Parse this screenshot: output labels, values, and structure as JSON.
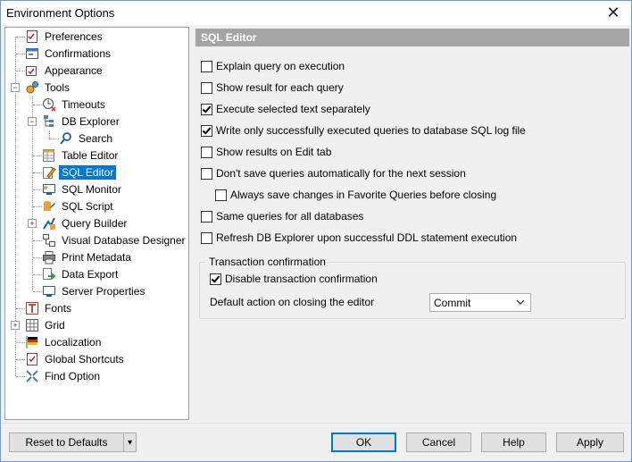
{
  "window": {
    "title": "Environment Options",
    "close_glyph": "✕"
  },
  "tree": {
    "items": [
      {
        "label": "Preferences",
        "icon": "document-icon"
      },
      {
        "label": "Confirmations",
        "icon": "dialog-icon"
      },
      {
        "label": "Appearance",
        "icon": "appearance-icon"
      },
      {
        "label": "Tools",
        "icon": "gears-icon",
        "expander": "−"
      },
      {
        "label": "Timeouts",
        "icon": "clock-icon"
      },
      {
        "label": "DB Explorer",
        "icon": "tree-icon",
        "expander": "−"
      },
      {
        "label": "Search",
        "icon": "search-icon"
      },
      {
        "label": "Table Editor",
        "icon": "table-icon"
      },
      {
        "label": "SQL Editor",
        "icon": "sql-editor-icon",
        "selected": true
      },
      {
        "label": "SQL Monitor",
        "icon": "monitor-icon"
      },
      {
        "label": "SQL Script",
        "icon": "script-icon"
      },
      {
        "label": "Query Builder",
        "icon": "query-builder-icon",
        "expander": "+"
      },
      {
        "label": "Visual Database Designer",
        "icon": "designer-icon"
      },
      {
        "label": "Print Metadata",
        "icon": "printer-icon"
      },
      {
        "label": "Data Export",
        "icon": "export-icon"
      },
      {
        "label": "Server Properties",
        "icon": "server-icon"
      },
      {
        "label": "Fonts",
        "icon": "font-icon"
      },
      {
        "label": "Grid",
        "icon": "grid-icon",
        "expander": "+"
      },
      {
        "label": "Localization",
        "icon": "flag-icon"
      },
      {
        "label": "Global Shortcuts",
        "icon": "shortcuts-icon"
      },
      {
        "label": "Find Option",
        "icon": "find-icon"
      }
    ]
  },
  "panel": {
    "header": "SQL Editor",
    "options": [
      {
        "label": "Explain query on execution",
        "checked": false
      },
      {
        "label": "Show result for each query",
        "checked": false
      },
      {
        "label": "Execute selected text separately",
        "checked": true
      },
      {
        "label": "Write only successfully executed queries to database SQL log file",
        "checked": true
      },
      {
        "label": "Show results on Edit tab",
        "checked": false
      },
      {
        "label": "Don't save queries automatically for the next session",
        "checked": false
      },
      {
        "label": "Always save changes in Favorite Queries before closing",
        "checked": false
      },
      {
        "label": "Same queries for all databases",
        "checked": false
      },
      {
        "label": "Refresh DB Explorer upon successful DDL statement execution",
        "checked": false
      }
    ],
    "transaction": {
      "title": "Transaction confirmation",
      "disable_label": "Disable transaction confirmation",
      "disable_checked": true,
      "default_action_label": "Default action on closing the editor",
      "default_action_value": "Commit"
    }
  },
  "buttons": {
    "reset": "Reset to Defaults",
    "reset_dropdown": "▾",
    "ok": "OK",
    "cancel": "Cancel",
    "help": "Help",
    "apply": "Apply"
  },
  "colors": {
    "selection": "#0078d7",
    "header_bg": "#a5a5a5"
  }
}
